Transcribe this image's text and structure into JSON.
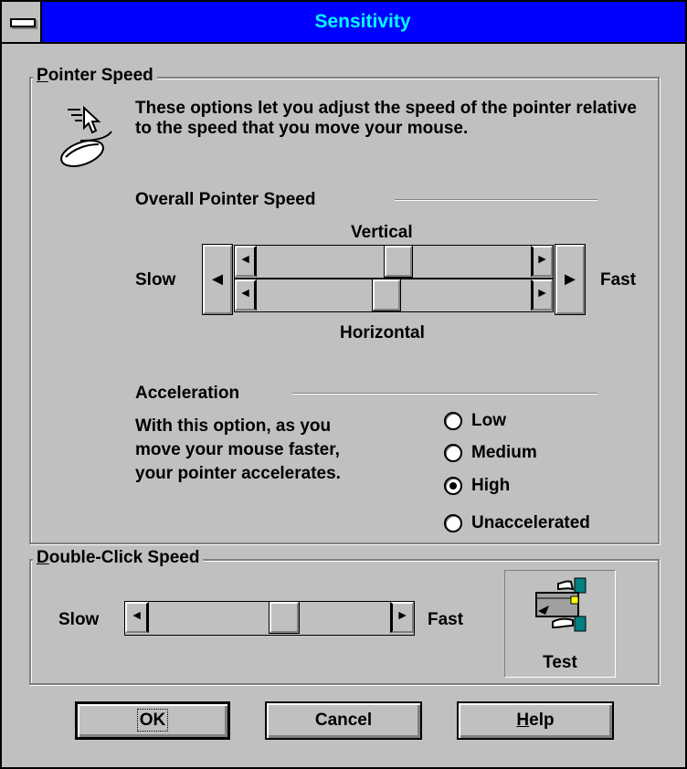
{
  "window": {
    "title": "Sensitivity"
  },
  "pointer_speed": {
    "group_label_prefix": "",
    "group_label_mnemonic": "P",
    "group_label_rest": "ointer Speed",
    "description": "These options let you adjust the speed of the pointer relative to the speed that you move your mouse.",
    "overall_label": "Overall Pointer Speed",
    "vertical_label": "Vertical",
    "horizontal_label": "Horizontal",
    "slow_label": "Slow",
    "fast_label": "Fast",
    "vertical_value": 0.52,
    "horizontal_value": 0.47
  },
  "acceleration": {
    "label": "Acceleration",
    "description_lines": [
      "With this option, as you",
      "move your mouse faster,",
      "your pointer accelerates."
    ],
    "options": [
      "Low",
      "Medium",
      "High",
      "Unaccelerated"
    ],
    "selected": "High"
  },
  "double_click": {
    "group_label_mnemonic": "D",
    "group_label_rest": "ouble-Click Speed",
    "slow_label": "Slow",
    "fast_label": "Fast",
    "value": 0.57,
    "test_label": "Test"
  },
  "buttons": {
    "ok": "OK",
    "cancel": "Cancel",
    "help_mnemonic": "H",
    "help_rest": "elp"
  },
  "icons": [
    "system-menu-icon",
    "mouse-pointer-icon",
    "hands-test-icon",
    "arrow-left-icon",
    "arrow-right-icon"
  ]
}
